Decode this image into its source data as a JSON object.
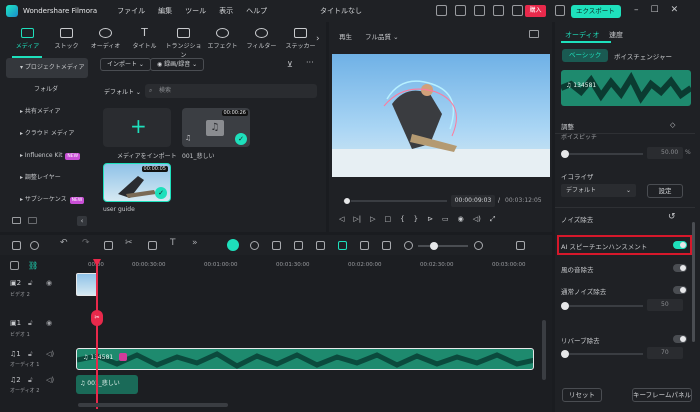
{
  "app": {
    "name": "Wondershare Filmora",
    "doc_title": "タイトルなし",
    "buy": "購入",
    "export": "エクスポート"
  },
  "menu": [
    "ファイル",
    "編集",
    "ツール",
    "表示",
    "ヘルプ"
  ],
  "lib_tabs": [
    "メディア",
    "ストック",
    "オーディオ",
    "タイトル",
    "トランジション",
    "エフェクト",
    "フィルター",
    "ステッカー"
  ],
  "sidebar": [
    {
      "label": "プロジェクトメディア",
      "selected": true
    },
    {
      "label": "フォルダ"
    },
    {
      "label": "共有メディア"
    },
    {
      "label": "クラウド メディア"
    },
    {
      "label": "Influence Kit",
      "badge": "NEW"
    },
    {
      "label": "調整レイヤー"
    },
    {
      "label": "サブシーケンス",
      "badge": "NEW"
    }
  ],
  "lib_toolbar": {
    "import": "インポート",
    "record": "録画/録音",
    "sort": "デフォルト",
    "search_placeholder": "検索"
  },
  "media": [
    {
      "caption": "メディアをインポート"
    },
    {
      "caption": "001_悲しい",
      "duration": "00:00:26"
    },
    {
      "caption": "user guide",
      "duration": "00:00:05"
    }
  ],
  "preview": {
    "play_label": "再生",
    "quality": "フル品質",
    "current": "00:00:09:03",
    "total": "00:03:12:05",
    "separator": "/",
    "progress_fraction": 0.04
  },
  "props": {
    "tabs": [
      "オーディオ",
      "速度"
    ],
    "subtabs": [
      "ベーシック",
      "ボイスチェンジャー"
    ],
    "clip_name": "134581",
    "adjust": "調整",
    "pitch_label": "ボイスピッチ",
    "pitch_value": "50.00",
    "pitch_unit": "%",
    "eq_label": "イコライザ",
    "eq_value": "デフォルト",
    "eq_button": "設定",
    "denoise": "ノイズ除去",
    "ai_speech": "AI スピーチエンハンスメント",
    "wind": "風の音除去",
    "normal_noise": "通常ノイズ除去",
    "normal_value": "50",
    "reverb": "リバーブ除去",
    "reverb_value": "70",
    "reset": "リセット",
    "keyframe": "キーフレームパネル"
  },
  "timeline": {
    "ruler": [
      "00:00",
      "00:00:30:00",
      "00:01:00:00",
      "00:01:30:00",
      "00:02:00:00",
      "00:02:30:00",
      "00:03:00:00"
    ],
    "tracks": [
      "ビデオ 2",
      "ビデオ 1",
      "オーディオ 1",
      "オーディオ 2"
    ],
    "audio1_clip": "134581",
    "audio2_clip": "001_悲しい"
  },
  "colors": {
    "accent": "#1ee0bc",
    "buy": "#e8294b",
    "highlight": "#d6182b",
    "audio_clip": "#1e8a6e"
  }
}
